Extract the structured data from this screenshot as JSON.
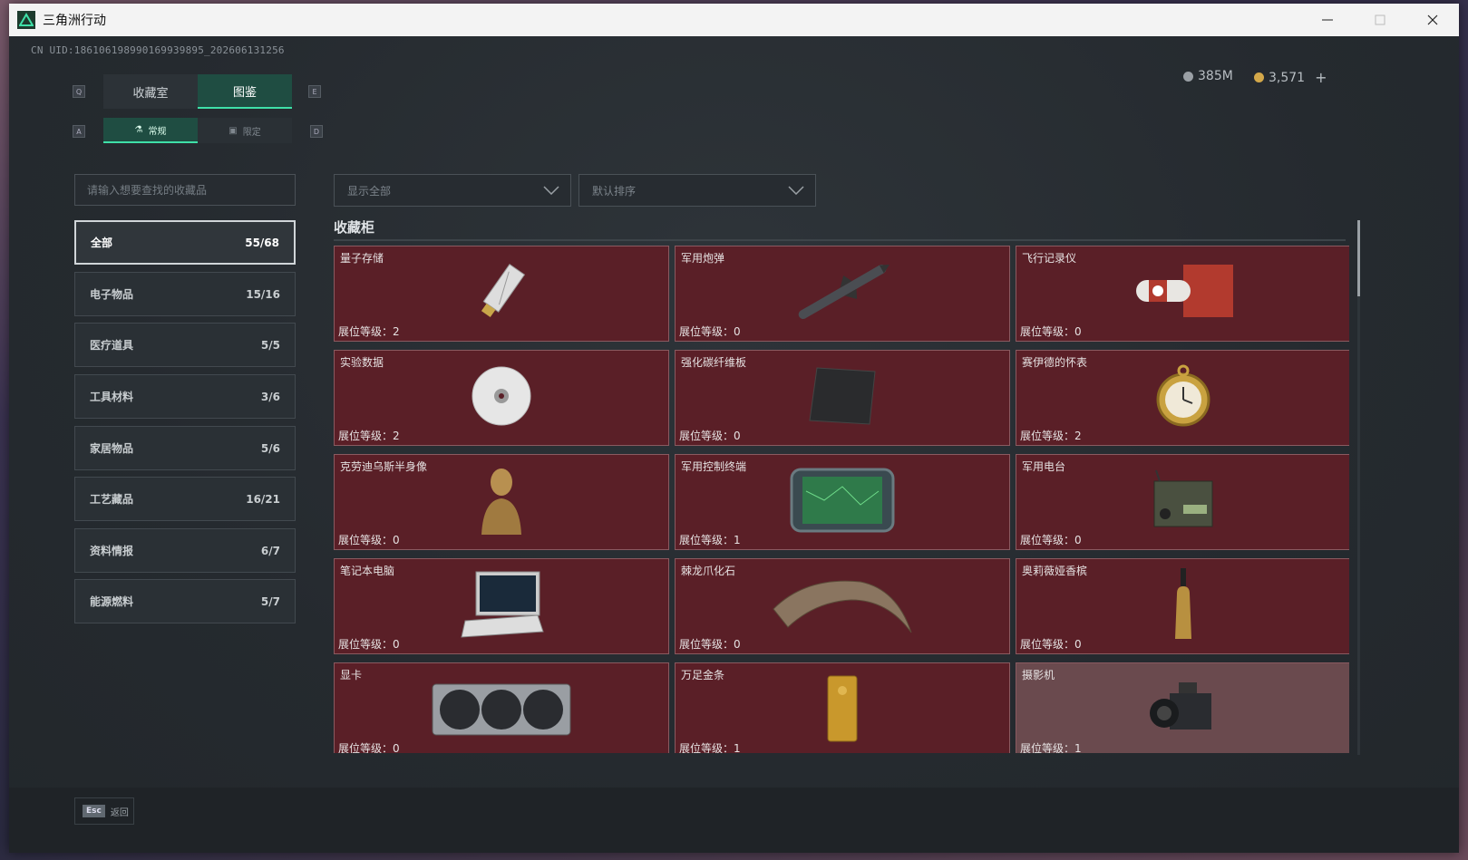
{
  "window": {
    "title": "三角洲行动"
  },
  "uid": "CN UID:1861061989901699398​95_202606131256",
  "hints": {
    "q": "Q",
    "e": "E",
    "a": "A",
    "d": "D"
  },
  "tabs": [
    {
      "label": "收藏室",
      "active": false
    },
    {
      "label": "图鉴",
      "active": true
    }
  ],
  "subtabs": [
    {
      "label": "常规",
      "active": true
    },
    {
      "label": "限定",
      "active": false
    }
  ],
  "currency": {
    "silver": "385M",
    "gold": "3,571",
    "plus": "+"
  },
  "search": {
    "placeholder": "请输入想要查找的收藏品"
  },
  "categories": [
    {
      "label": "全部",
      "count": "55/68",
      "active": true
    },
    {
      "label": "电子物品",
      "count": "15/16"
    },
    {
      "label": "医疗道具",
      "count": "5/5"
    },
    {
      "label": "工具材料",
      "count": "3/6"
    },
    {
      "label": "家居物品",
      "count": "5/6"
    },
    {
      "label": "工艺藏品",
      "count": "16/21"
    },
    {
      "label": "资料情报",
      "count": "6/7"
    },
    {
      "label": "能源燃料",
      "count": "5/7"
    }
  ],
  "filters": {
    "show": "显示全部",
    "sort": "默认排序"
  },
  "section": {
    "title": "收藏柜"
  },
  "items": [
    {
      "name": "量子存储",
      "level": "展位等级：2",
      "icon": "usb-drive-icon"
    },
    {
      "name": "军用炮弹",
      "level": "展位等级：0",
      "icon": "missile-icon"
    },
    {
      "name": "飞行记录仪",
      "level": "展位等级：0",
      "icon": "flight-recorder-icon"
    },
    {
      "name": "实验数据",
      "level": "展位等级：2",
      "icon": "disc-icon"
    },
    {
      "name": "强化碳纤维板",
      "level": "展位等级：0",
      "icon": "carbon-plate-icon"
    },
    {
      "name": "赛伊德的怀表",
      "level": "展位等级：2",
      "icon": "pocket-watch-icon"
    },
    {
      "name": "克劳迪乌斯半身像",
      "level": "展位等级：0",
      "icon": "bust-icon"
    },
    {
      "name": "军用控制终端",
      "level": "展位等级：1",
      "icon": "control-terminal-icon"
    },
    {
      "name": "军用电台",
      "level": "展位等级：0",
      "icon": "radio-icon"
    },
    {
      "name": "笔记本电脑",
      "level": "展位等级：0",
      "icon": "laptop-icon"
    },
    {
      "name": "棘龙爪化石",
      "level": "展位等级：0",
      "icon": "claw-fossil-icon"
    },
    {
      "name": "奥莉薇娅香槟",
      "level": "展位等级：0",
      "icon": "champagne-icon"
    },
    {
      "name": "显卡",
      "level": "展位等级：0",
      "icon": "graphics-card-icon"
    },
    {
      "name": "万足金条",
      "level": "展位等级：1",
      "icon": "gold-bar-icon"
    },
    {
      "name": "摄影机",
      "level": "展位等级：1",
      "icon": "camera-icon"
    }
  ],
  "footer": {
    "esc_key": "Esc",
    "back_label": "返回"
  }
}
